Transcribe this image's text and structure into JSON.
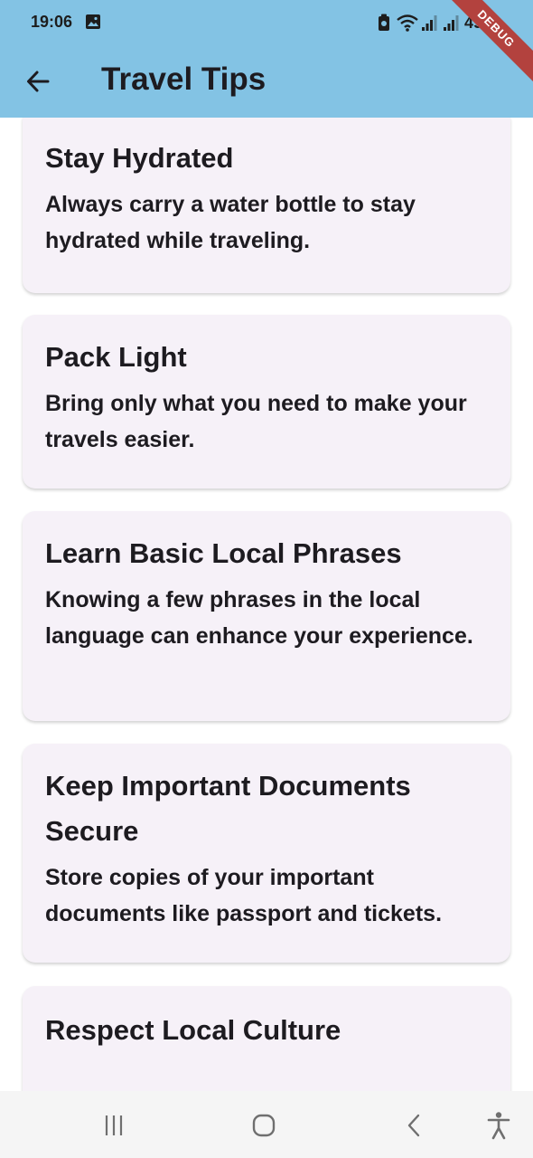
{
  "status_bar": {
    "time": "19:06",
    "battery": "49%",
    "debug_label": "DEBUG"
  },
  "app_bar": {
    "title": "Travel Tips",
    "back_icon": "arrow-left-icon"
  },
  "tips": [
    {
      "title": "Stay Hydrated",
      "description": "Always carry a water bottle to stay hydrated while traveling."
    },
    {
      "title": "Pack Light",
      "description": "Bring only what you need to make your travels easier."
    },
    {
      "title": "Learn Basic Local Phrases",
      "description": "Knowing a few phrases in the local language can enhance your experience."
    },
    {
      "title": "Keep Important Documents Secure",
      "description": "Store copies of your important documents like passport and tickets."
    },
    {
      "title": "Respect Local Culture",
      "description": ""
    }
  ],
  "nav_bar": {
    "icons": [
      "recent-apps-icon",
      "home-icon",
      "back-icon",
      "accessibility-icon"
    ]
  },
  "colors": {
    "app_bar": "#83c3e4",
    "card_background": "#f6f1f8",
    "text": "#1d1b20",
    "debug_ribbon": "#b3423e"
  }
}
